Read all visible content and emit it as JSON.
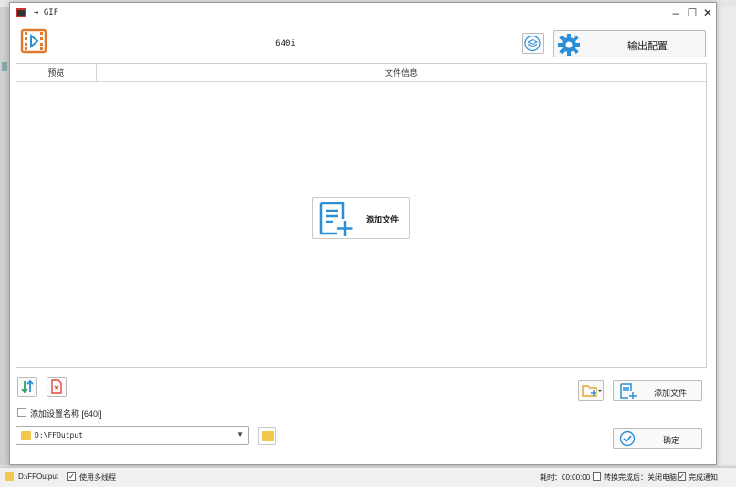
{
  "window": {
    "title": "→ GIF",
    "preset_name": "640i",
    "output_config_label": "输出配置"
  },
  "file_list": {
    "columns": [
      "预览",
      "文件信息"
    ],
    "center_add_label": "添加文件"
  },
  "options": {
    "add_preset_name_label": "添加设置名称 [640i]",
    "add_preset_name_checked": false
  },
  "output": {
    "path": "D:\\FFOutput"
  },
  "buttons": {
    "add_file_label": "添加文件",
    "ok_label": "确定"
  },
  "statusbar": {
    "path": "D:\\FFOutput",
    "multithread_label": "使用多线程",
    "multithread_checked": true,
    "elapsed_label": "耗时：00:00:00",
    "after_convert_label": "转换完成后：关闭电脑",
    "after_convert_checked": false,
    "notify_label": "完成通知",
    "notify_checked": true
  },
  "colors": {
    "accent_orange": "#e07a2e",
    "accent_blue": "#2a8fd6",
    "accent_red": "#e0493b",
    "folder_yellow": "#f2c94c"
  }
}
